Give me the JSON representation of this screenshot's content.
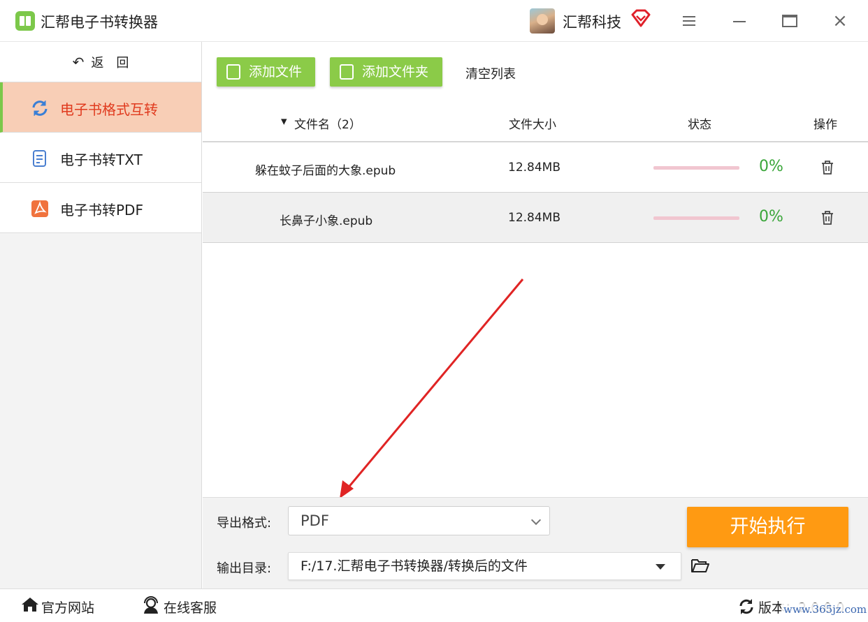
{
  "app": {
    "title": "汇帮电子书转换器",
    "user_name": "汇帮科技"
  },
  "sidebar": {
    "back_label": "返　回",
    "items": [
      {
        "label": "电子书格式互转",
        "icon": "refresh-icon"
      },
      {
        "label": "电子书转TXT",
        "icon": "document-icon"
      },
      {
        "label": "电子书转PDF",
        "icon": "pdf-icon"
      }
    ]
  },
  "toolbar": {
    "add_file": "添加文件",
    "add_folder": "添加文件夹",
    "clear_list": "清空列表"
  },
  "table": {
    "headers": {
      "filename": "文件名（2）",
      "size": "文件大小",
      "status": "状态",
      "action": "操作"
    },
    "rows": [
      {
        "filename": "躲在蚊子后面的大象.epub",
        "size": "12.84MB",
        "percent": "0%",
        "progress": 0
      },
      {
        "filename": "长鼻子小象.epub",
        "size": "12.84MB",
        "percent": "0%",
        "progress": 0
      }
    ]
  },
  "settings": {
    "format_label": "导出格式:",
    "format_value": "PDF",
    "dir_label": "输出目录:",
    "dir_value": "F:/17.汇帮电子书转换器/转换后的文件",
    "start_label": "开始执行"
  },
  "footer": {
    "website": "官方网站",
    "support": "在线客服",
    "version": "版本：2.0.0.0"
  },
  "watermark": "www.365jz.com",
  "colors": {
    "accent_green": "#8bcb48",
    "start_orange": "#ff9a12",
    "active_bg": "#f8ceb6",
    "active_text": "#e03a1e",
    "percent_green": "#3aa63a"
  }
}
